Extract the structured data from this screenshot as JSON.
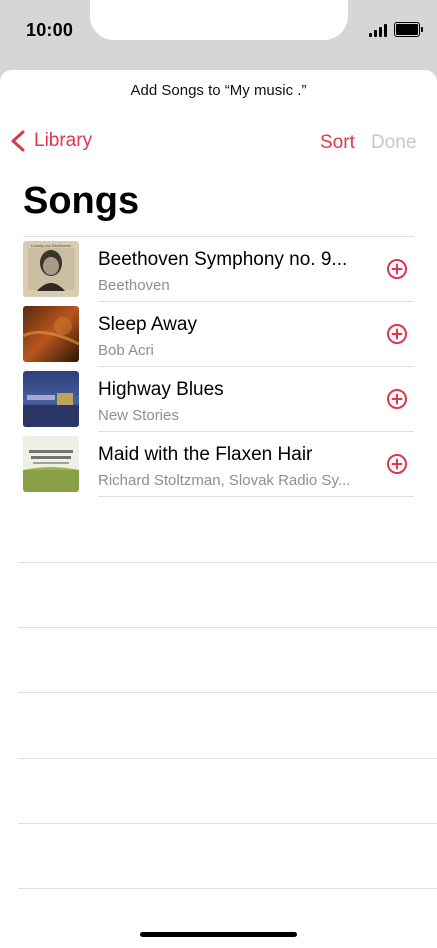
{
  "status_bar": {
    "time": "10:00",
    "icons": [
      "signal-icon",
      "battery-icon"
    ]
  },
  "sheet": {
    "prompt": "Add Songs to “My music .”",
    "nav": {
      "back_label": "Library",
      "sort_label": "Sort",
      "done_label": "Done"
    },
    "title": "Songs",
    "songs": [
      {
        "title": "Beethoven Symphony no. 9...",
        "artist": "Beethoven"
      },
      {
        "title": "Sleep Away",
        "artist": "Bob Acri"
      },
      {
        "title": "Highway Blues",
        "artist": "New Stories"
      },
      {
        "title": "Maid with the Flaxen Hair",
        "artist": "Richard Stoltzman, Slovak Radio Sy..."
      }
    ]
  },
  "colors": {
    "accent": "#e0354d",
    "disabled": "#c7c7cc",
    "secondary_text": "#8e8e93"
  }
}
